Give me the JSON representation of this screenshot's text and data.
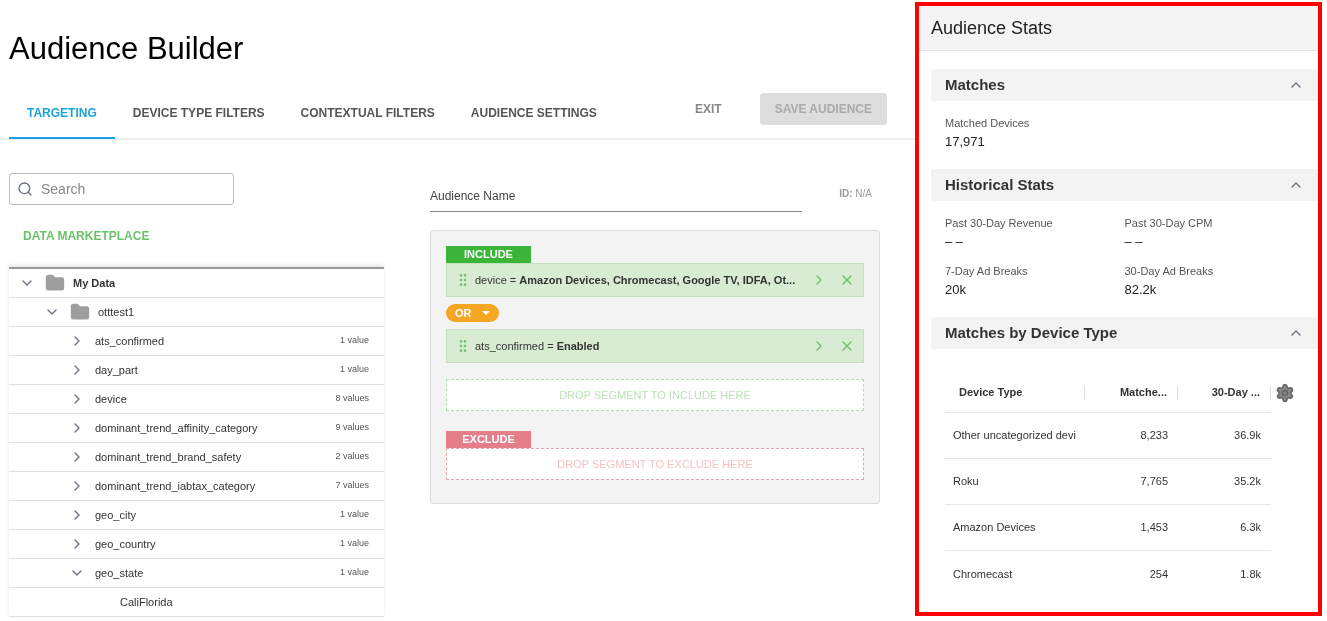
{
  "title": "Audience Builder",
  "tabs": [
    {
      "label": "TARGETING",
      "selected": true
    },
    {
      "label": "DEVICE TYPE FILTERS",
      "selected": false
    },
    {
      "label": "CONTEXTUAL FILTERS",
      "selected": false
    },
    {
      "label": "AUDIENCE SETTINGS",
      "selected": false
    }
  ],
  "actions": {
    "exit": "EXIT",
    "save": {
      "label": "SAVE AUDIENCE",
      "disabled": true
    }
  },
  "search": {
    "placeholder": "Search"
  },
  "marketplace_link": "DATA MARKETPLACE",
  "tree": [
    {
      "label": "My Data",
      "kind": "folder",
      "expanded": true,
      "children": [
        {
          "label": "otttest1",
          "kind": "folder",
          "expanded": true,
          "children": [
            {
              "label": "ats_confirmed",
              "kind": "attribute",
              "count": "1 value",
              "expanded": false
            },
            {
              "label": "day_part",
              "kind": "attribute",
              "count": "1 value",
              "expanded": false
            },
            {
              "label": "device",
              "kind": "attribute",
              "count": "8 values",
              "expanded": false
            },
            {
              "label": "dominant_trend_affinity_category",
              "kind": "attribute",
              "count": "9 values",
              "expanded": false
            },
            {
              "label": "dominant_trend_brand_safety",
              "kind": "attribute",
              "count": "2 values",
              "expanded": false
            },
            {
              "label": "dominant_trend_iabtax_category",
              "kind": "attribute",
              "count": "7 values",
              "expanded": false
            },
            {
              "label": "geo_city",
              "kind": "attribute",
              "count": "1 value",
              "expanded": false
            },
            {
              "label": "geo_country",
              "kind": "attribute",
              "count": "1 value",
              "expanded": false
            },
            {
              "label": "geo_state",
              "kind": "attribute",
              "count": "1 value",
              "expanded": true,
              "children": [
                {
                  "label": "CaliFlorida",
                  "kind": "value"
                }
              ]
            }
          ]
        }
      ]
    }
  ],
  "audience_name": {
    "placeholder": "Audience Name"
  },
  "id_label": "ID:",
  "id_value": "N/A",
  "include": {
    "label": "INCLUDE",
    "segments": [
      {
        "field": "device =",
        "value": "Amazon Devices, Chromecast, Google TV, IDFA, Ot..."
      },
      {
        "field": "ats_confirmed =",
        "value": "Enabled"
      }
    ],
    "operator": "OR",
    "drop_hint": "DROP SEGMENT TO INCLUDE HERE"
  },
  "exclude": {
    "label": "EXCLUDE",
    "drop_hint": "DROP SEGMENT TO EXCLUDE HERE"
  },
  "stats": {
    "title": "Audience Stats",
    "sections": [
      {
        "title": "Matches",
        "expanded": true,
        "kind": "metrics",
        "metrics": [
          {
            "label": "Matched Devices",
            "value": "17,971"
          }
        ]
      },
      {
        "title": "Historical Stats",
        "expanded": true,
        "kind": "metrics",
        "metrics": [
          {
            "label": "Past 30-Day Revenue",
            "value": "– –"
          },
          {
            "label": "Past 30-Day CPM",
            "value": "– –"
          },
          {
            "label": "7-Day Ad Breaks",
            "value": "20k"
          },
          {
            "label": "30-Day Ad Breaks",
            "value": "82.2k"
          }
        ]
      },
      {
        "title": "Matches by Device Type",
        "expanded": true,
        "kind": "table",
        "columns": [
          "Device Type",
          "Matche...",
          "30-Day ..."
        ],
        "rows": [
          [
            "Other uncategorized devi",
            "8,233",
            "36.9k"
          ],
          [
            "Roku",
            "7,765",
            "35.2k"
          ],
          [
            "Amazon Devices",
            "1,453",
            "6.3k"
          ],
          [
            "Chromecast",
            "254",
            "1.8k"
          ]
        ]
      }
    ]
  }
}
